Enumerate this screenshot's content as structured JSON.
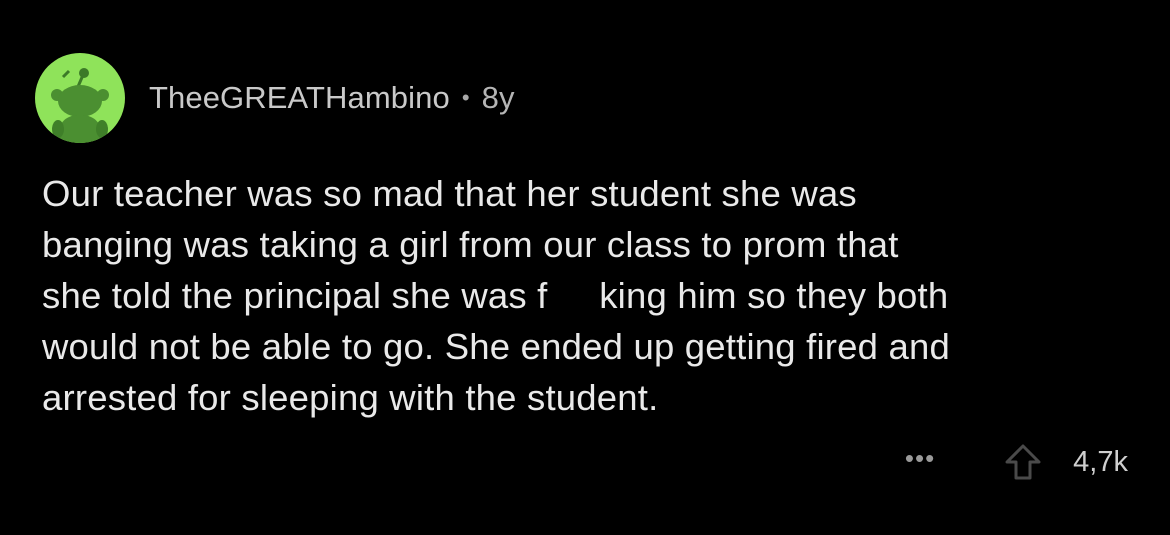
{
  "comment": {
    "author": "TheeGREATHambino",
    "separator": "•",
    "age": "8y",
    "body_lines": [
      "Our teacher was so mad that her student she was",
      "banging was taking a girl from our class to prom that",
      "she told the principal she was f     king him so they both",
      "would not be able to go. She ended up getting fired and",
      "arrested for sleeping with the student."
    ],
    "more_label": "•••",
    "score": "4,7k"
  },
  "icons": {
    "avatar": "reddit-snoo-avatar",
    "upvote": "upvote-arrow-icon"
  },
  "colors": {
    "background": "#000000",
    "avatar_bg": "#8fe35a",
    "text": "#e9e9e9",
    "meta_text": "#c9c9c9"
  }
}
